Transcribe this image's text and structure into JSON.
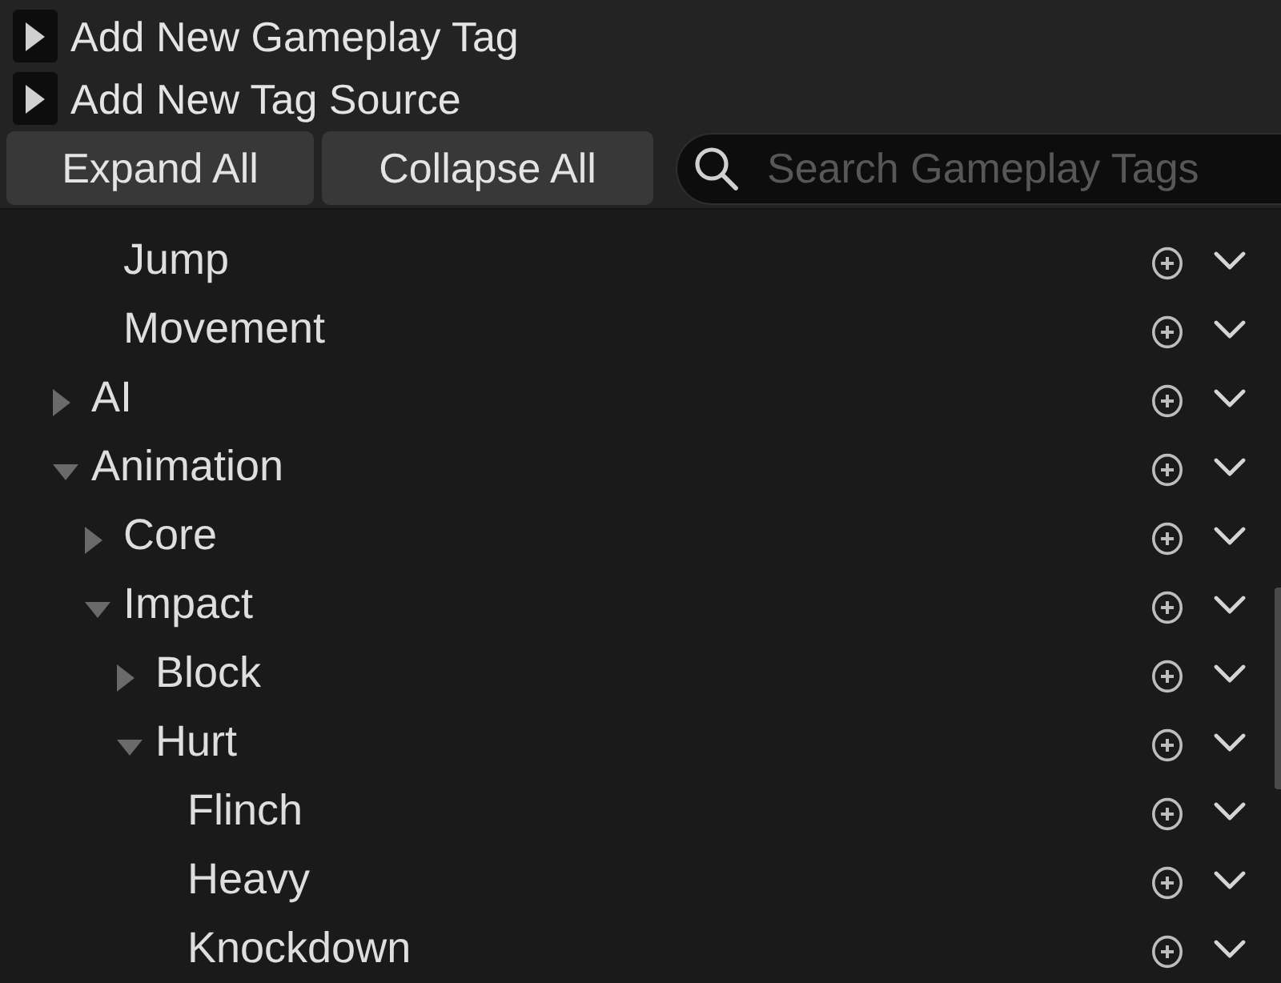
{
  "sections": [
    {
      "label": "Add New Gameplay Tag",
      "expanded": false
    },
    {
      "label": "Add New Tag Source",
      "expanded": false
    }
  ],
  "buttons": [
    "Expand All",
    "Collapse All"
  ],
  "search": {
    "placeholder": "Search Gameplay Tags"
  },
  "tree": [
    {
      "children": [
        {
          "label": "Jump"
        },
        {
          "label": "Movement"
        }
      ]
    },
    {
      "label": "AI",
      "expanded": false
    },
    {
      "label": "Animation",
      "expanded": true,
      "children": [
        {
          "label": "Core",
          "expanded": false
        },
        {
          "label": "Impact",
          "expanded": true,
          "children": [
            {
              "label": "Block",
              "expanded": false
            },
            {
              "label": "Hurt",
              "expanded": true,
              "children": [
                {
                  "label": "Flinch"
                },
                {
                  "label": "Heavy"
                },
                {
                  "label": "Knockdown"
                }
              ]
            }
          ]
        }
      ]
    }
  ]
}
